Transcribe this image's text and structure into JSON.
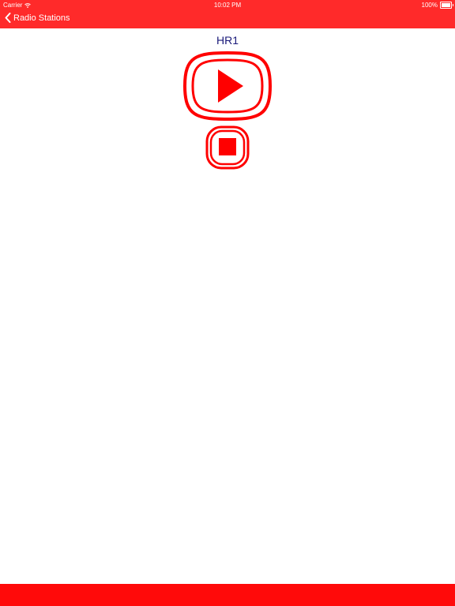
{
  "status_bar": {
    "carrier": "Carrier",
    "time": "10:02 PM",
    "battery": "100%"
  },
  "nav": {
    "back_label": "Radio Stations"
  },
  "station": {
    "name": "HR1"
  },
  "icons": {
    "wifi": "wifi-icon",
    "battery": "battery-icon",
    "back": "chevron-left-icon",
    "play": "play-icon",
    "stop": "stop-icon"
  },
  "colors": {
    "header": "#ff2a2a",
    "accent": "#ff0000",
    "title": "#1a1a7a",
    "bottom_bar": "#ff0a0a"
  }
}
